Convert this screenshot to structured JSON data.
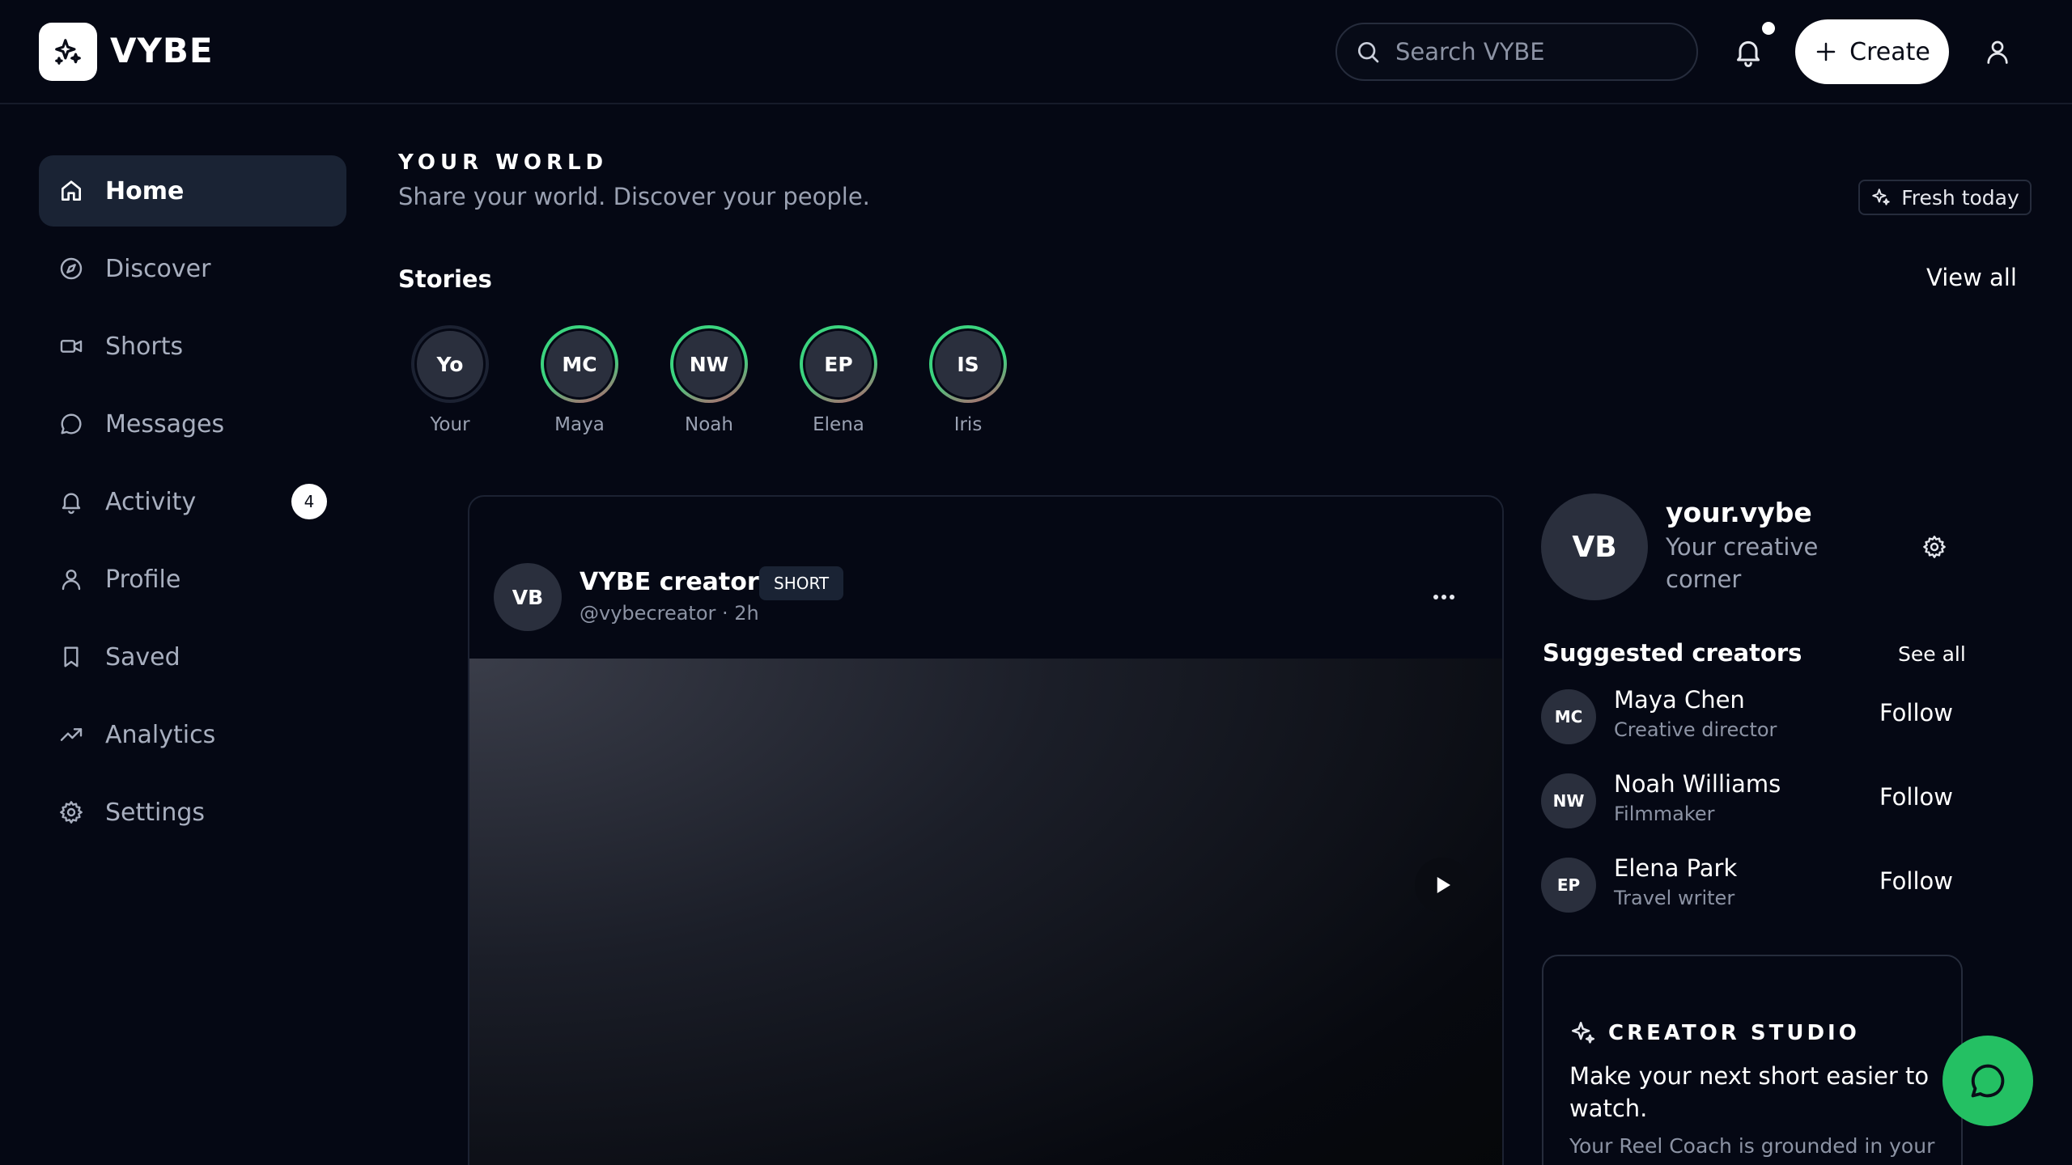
{
  "app": {
    "name": "VYBE"
  },
  "search": {
    "placeholder": "Search VYBE"
  },
  "header": {
    "create_label": "Create"
  },
  "sidebar": {
    "items": [
      {
        "label": "Home",
        "active": true
      },
      {
        "label": "Discover"
      },
      {
        "label": "Shorts"
      },
      {
        "label": "Messages"
      },
      {
        "label": "Activity",
        "badge": "4"
      },
      {
        "label": "Profile"
      },
      {
        "label": "Saved"
      },
      {
        "label": "Analytics"
      },
      {
        "label": "Settings"
      }
    ]
  },
  "feed": {
    "eyebrow": "YOUR WORLD",
    "tagline": "Share your world. Discover your people.",
    "fresh_label": "Fresh today",
    "stories_title": "Stories",
    "view_all": "View all",
    "stories": [
      {
        "initials": "Yo",
        "name": "Your"
      },
      {
        "initials": "MC",
        "name": "Maya"
      },
      {
        "initials": "NW",
        "name": "Noah"
      },
      {
        "initials": "EP",
        "name": "Elena"
      },
      {
        "initials": "IS",
        "name": "Iris"
      }
    ],
    "post": {
      "avatar_initials": "VB",
      "author": "VYBE creator",
      "tag": "SHORT",
      "handle": "@vybecreator · 2h"
    }
  },
  "profile_card": {
    "initials": "VB",
    "username": "your.vybe",
    "subtitle": "Your creative corner"
  },
  "suggested": {
    "title": "Suggested creators",
    "see_all": "See all",
    "follow_label": "Follow",
    "creators": [
      {
        "initials": "MC",
        "name": "Maya Chen",
        "role": "Creative director"
      },
      {
        "initials": "NW",
        "name": "Noah Williams",
        "role": "Filmmaker"
      },
      {
        "initials": "EP",
        "name": "Elena Park",
        "role": "Travel writer"
      }
    ]
  },
  "creator_studio": {
    "label": "CREATOR STUDIO",
    "title": "Make your next short easier to watch.",
    "body": "Your Reel Coach is grounded in your"
  },
  "colors": {
    "background": "#050814",
    "accent_green": "#24c063",
    "active_nav": "#1a2334"
  },
  "icons": {
    "logo": "sparkle-icon",
    "search": "search-icon",
    "notifications": "bell-icon",
    "create": "plus-icon",
    "account": "user-icon",
    "chat": "chat-bubble-icon"
  }
}
